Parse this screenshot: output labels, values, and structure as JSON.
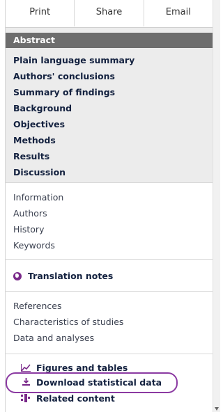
{
  "actions": [
    "Print",
    "Share",
    "Email"
  ],
  "contents": {
    "selected": "Abstract",
    "items": [
      "Plain language summary",
      "Authors' conclusions",
      "Summary of findings",
      "Background",
      "Objectives",
      "Methods",
      "Results",
      "Discussion"
    ]
  },
  "info_links": [
    "Information",
    "Authors",
    "History",
    "Keywords"
  ],
  "translation_notes": "Translation notes",
  "ref_links": [
    "References",
    "Characteristics of studies",
    "Data and analyses"
  ],
  "tools": {
    "figures": "Figures and tables",
    "download": "Download statistical data",
    "related": "Related content"
  },
  "colors": {
    "accent": "#8b3aa2",
    "selected_bg": "#6d6d6d",
    "panel_bg": "#ececec"
  }
}
